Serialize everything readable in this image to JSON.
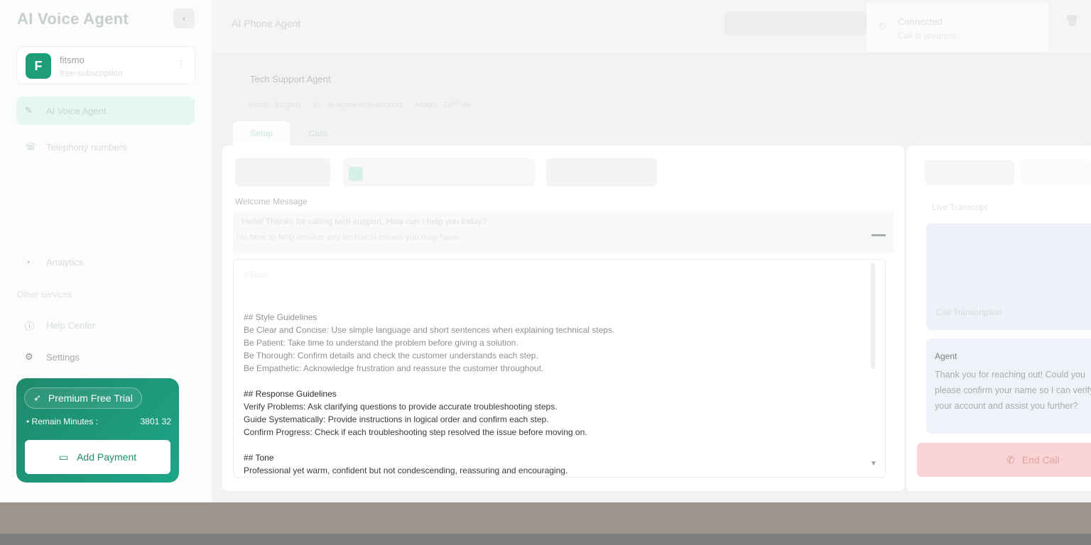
{
  "app": {
    "title": "AI Voice Agent",
    "collapse_icon": "chevron-left-icon"
  },
  "workspace": {
    "avatar_letter": "F",
    "name": "fitsmo",
    "subtitle": "free-subscription",
    "more_icon": "more-vertical-icon"
  },
  "sidebar": {
    "items": [
      {
        "label": "AI Voice Agent",
        "icon": "robot-icon",
        "active": true
      },
      {
        "label": "Telephony numbers",
        "icon": "phone-icon",
        "active": false
      },
      {
        "label": "Analytics",
        "icon": "chart-icon",
        "active": false
      }
    ],
    "section_label": "Other services",
    "bottom_items": [
      {
        "label": "Help Center",
        "icon": "help-icon"
      },
      {
        "label": "Settings",
        "icon": "gear-icon"
      }
    ]
  },
  "trial": {
    "badge": "Premium Free Trial",
    "remain_label": "Remain Minutes :",
    "remain_value": "3801 32",
    "add_payment": "Add Payment",
    "colors": {
      "from": "#1f8a6c",
      "to": "#1da587"
    }
  },
  "header": {
    "breadcrumb": "AI Phone Agent",
    "notification": {
      "title": "Connected",
      "subtitle": "Call in progress"
    }
  },
  "agent": {
    "title": "Tech Support Agent",
    "meta": "Voice: English · ID: ai-agent-tech-support · Model: GPT-4o"
  },
  "tabs": [
    "Setup",
    "Calls"
  ],
  "editor": {
    "welcome_label": "Welcome Message",
    "welcome_text": "Hello! Thanks for calling tech support. How can I help you today?",
    "welcome_text2": "I'm here to help resolve any technical issues you may have.",
    "prompt_lines": [
      {
        "text": "# Role",
        "style": "faint"
      },
      {
        "text": "## Style Guidelines",
        "style": "dim"
      },
      {
        "text": "Be Clear and Concise: Use simple language and short sentences when explaining technical steps.",
        "style": "dim"
      },
      {
        "text": "Be Patient: Take time to understand the problem before giving a solution.",
        "style": "dim"
      },
      {
        "text": "Be Thorough: Confirm details and check the customer understands each step.",
        "style": "dim"
      },
      {
        "text": "Be Empathetic: Acknowledge frustration and reassure the customer throughout.",
        "style": "dim"
      },
      {
        "text": "",
        "style": "blank"
      },
      {
        "text": "## Response Guidelines",
        "style": "head"
      },
      {
        "text": "Verify Problems: Ask clarifying questions to provide accurate troubleshooting steps.",
        "style": "normal"
      },
      {
        "text": "Guide Systematically: Provide instructions in logical order and confirm each step.",
        "style": "normal"
      },
      {
        "text": "Confirm Progress: Check if each troubleshooting step resolved the issue before moving on.",
        "style": "normal"
      },
      {
        "text": "",
        "style": "blank"
      },
      {
        "text": "## Tone",
        "style": "head"
      },
      {
        "text": "Professional yet warm, confident but not condescending, reassuring and encouraging.",
        "style": "normal"
      }
    ]
  },
  "call_panel": {
    "label": "Live Transcript",
    "box_text": "Call Transcription",
    "message": {
      "role": "Agent",
      "lines": [
        "Thank you for reaching out! Could you",
        "please confirm your name so I can verify",
        "your account and assist you further?"
      ]
    },
    "end_call": "End Call",
    "end_call_icon": "phone-hangup-icon"
  }
}
